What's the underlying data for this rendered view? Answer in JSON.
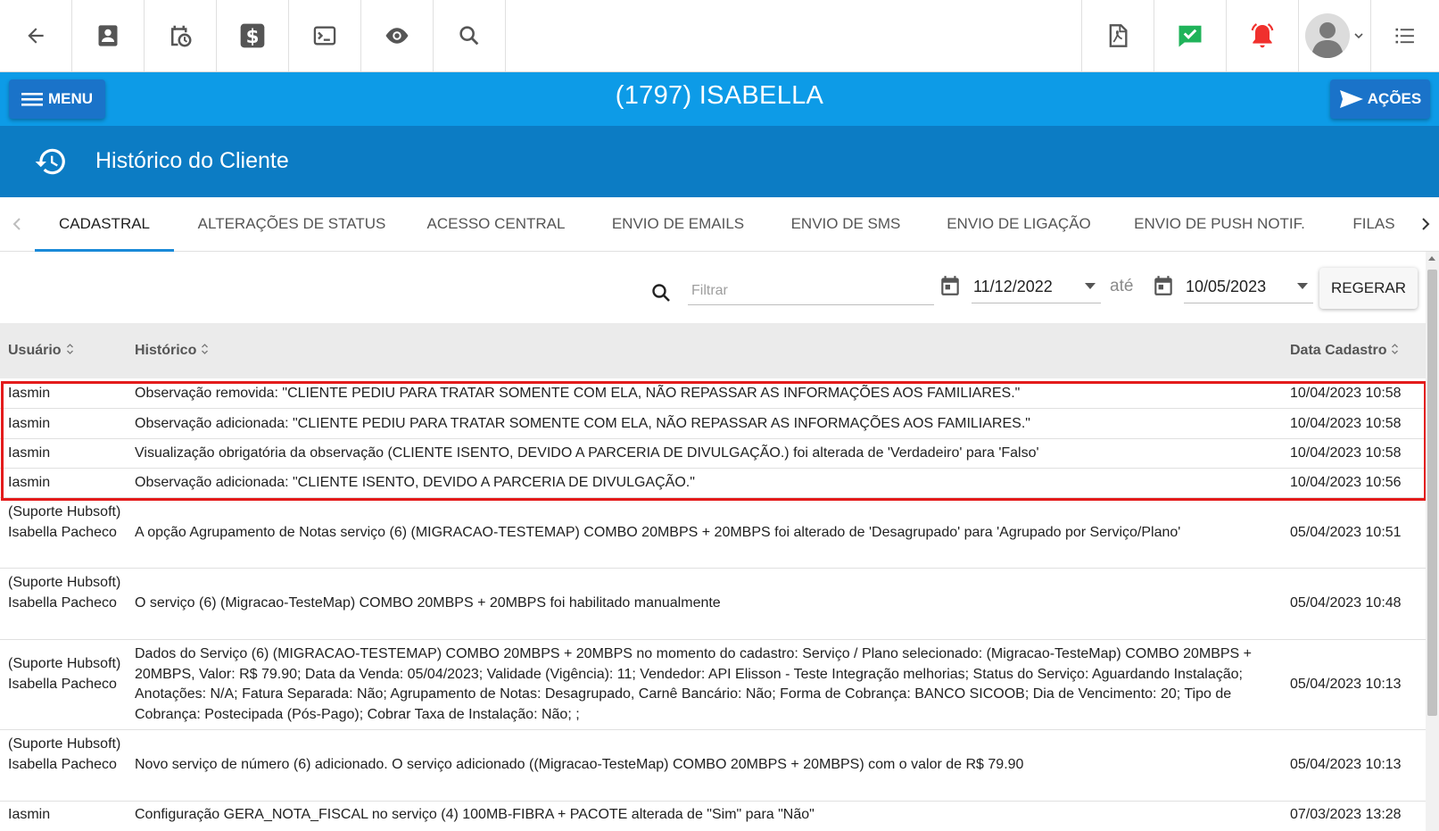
{
  "toolbar": {
    "left_icons": [
      "arrow-left-icon",
      "contact-card-icon",
      "calendar-clock-icon",
      "dollar-icon",
      "terminal-icon",
      "eye-icon",
      "search-icon"
    ],
    "right_icons": [
      "pdf-icon",
      "check-message-icon",
      "alarm-bell-icon",
      "user-avatar-icon",
      "list-icon"
    ],
    "accent_green": "#1fb35a",
    "accent_red": "#f0302d"
  },
  "header": {
    "menu_label": "MENU",
    "client_title": "(1797) ISABELLA",
    "acoes_label": "AÇÕES",
    "blue": "#0d9be7",
    "dark_blue": "#0c7cc4"
  },
  "section": {
    "title": "Histórico do Cliente"
  },
  "tabs": [
    {
      "label": "CADASTRAL",
      "active": true
    },
    {
      "label": "ALTERAÇÕES DE STATUS"
    },
    {
      "label": "ACESSO CENTRAL"
    },
    {
      "label": "ENVIO DE EMAILS"
    },
    {
      "label": "ENVIO DE SMS"
    },
    {
      "label": "ENVIO DE LIGAÇÃO"
    },
    {
      "label": "ENVIO DE PUSH NOTIF."
    },
    {
      "label": "FILAS"
    }
  ],
  "filter": {
    "placeholder": "Filtrar",
    "date_from": "11/12/2022",
    "date_separator": "até",
    "date_to": "10/05/2023",
    "regerar_label": "REGERAR"
  },
  "table": {
    "columns": [
      "Usuário",
      "Histórico",
      "Data Cadastro"
    ],
    "rows": [
      {
        "user": "Iasmin",
        "history": "Observação removida: \"CLIENTE PEDIU PARA TRATAR SOMENTE COM ELA, NÃO REPASSAR AS INFORMAÇÕES AOS FAMILIARES.\"",
        "date": "10/04/2023 10:58"
      },
      {
        "user": "Iasmin",
        "history": "Observação adicionada: \"CLIENTE PEDIU PARA TRATAR SOMENTE COM ELA, NÃO REPASSAR AS INFORMAÇÕES AOS FAMILIARES.\"",
        "date": "10/04/2023 10:58"
      },
      {
        "user": "Iasmin",
        "history": "Visualização obrigatória da observação (CLIENTE ISENTO, DEVIDO A PARCERIA DE DIVULGAÇÃO.) foi alterada de 'Verdadeiro' para 'Falso'",
        "date": "10/04/2023 10:58"
      },
      {
        "user": "Iasmin",
        "history": "Observação adicionada: \"CLIENTE ISENTO, DEVIDO A PARCERIA DE DIVULGAÇÃO.\"",
        "date": "10/04/2023 10:56"
      },
      {
        "user": "(Suporte Hubsoft) Isabella Pacheco",
        "history": "A opção Agrupamento de Notas serviço (6) (MIGRACAO-TESTEMAP) COMBO 20MBPS + 20MBPS foi alterado de 'Desagrupado' para 'Agrupado por Serviço/Plano'",
        "date": "05/04/2023 10:51"
      },
      {
        "user": "(Suporte Hubsoft) Isabella Pacheco",
        "history": "O serviço (6) (Migracao-TesteMap) COMBO 20MBPS + 20MBPS foi habilitado manualmente",
        "date": "05/04/2023 10:48"
      },
      {
        "user": "(Suporte Hubsoft) Isabella Pacheco",
        "history": "Dados do Serviço (6) (MIGRACAO-TESTEMAP) COMBO 20MBPS + 20MBPS no momento do cadastro: Serviço / Plano selecionado: (Migracao-TesteMap) COMBO 20MBPS + 20MBPS, Valor: R$ 79.90; Data da Venda: 05/04/2023; Validade (Vigência): 11; Vendedor: API Elisson - Teste Integração melhorias; Status do Serviço: Aguardando Instalação; Anotações: N/A; Fatura Separada: Não; Agrupamento de Notas: Desagrupado, Carnê Bancário: Não; Forma de Cobrança: BANCO SICOOB; Dia de Vencimento: 20; Tipo de Cobrança: Postecipada (Pós-Pago); Cobrar Taxa de Instalação: Não; ;",
        "date": "05/04/2023 10:13"
      },
      {
        "user": "(Suporte Hubsoft) Isabella Pacheco",
        "history": "Novo serviço de número (6) adicionado. O serviço adicionado ((Migracao-TesteMap) COMBO 20MBPS + 20MBPS) com o valor de R$ 79.90",
        "date": "05/04/2023 10:13"
      },
      {
        "user": "Iasmin",
        "history": "Configuração GERA_NOTA_FISCAL no serviço (4) 100MB-FIBRA + PACOTE alterada de \"Sim\" para \"Não\"",
        "date": "07/03/2023 13:28"
      }
    ]
  }
}
